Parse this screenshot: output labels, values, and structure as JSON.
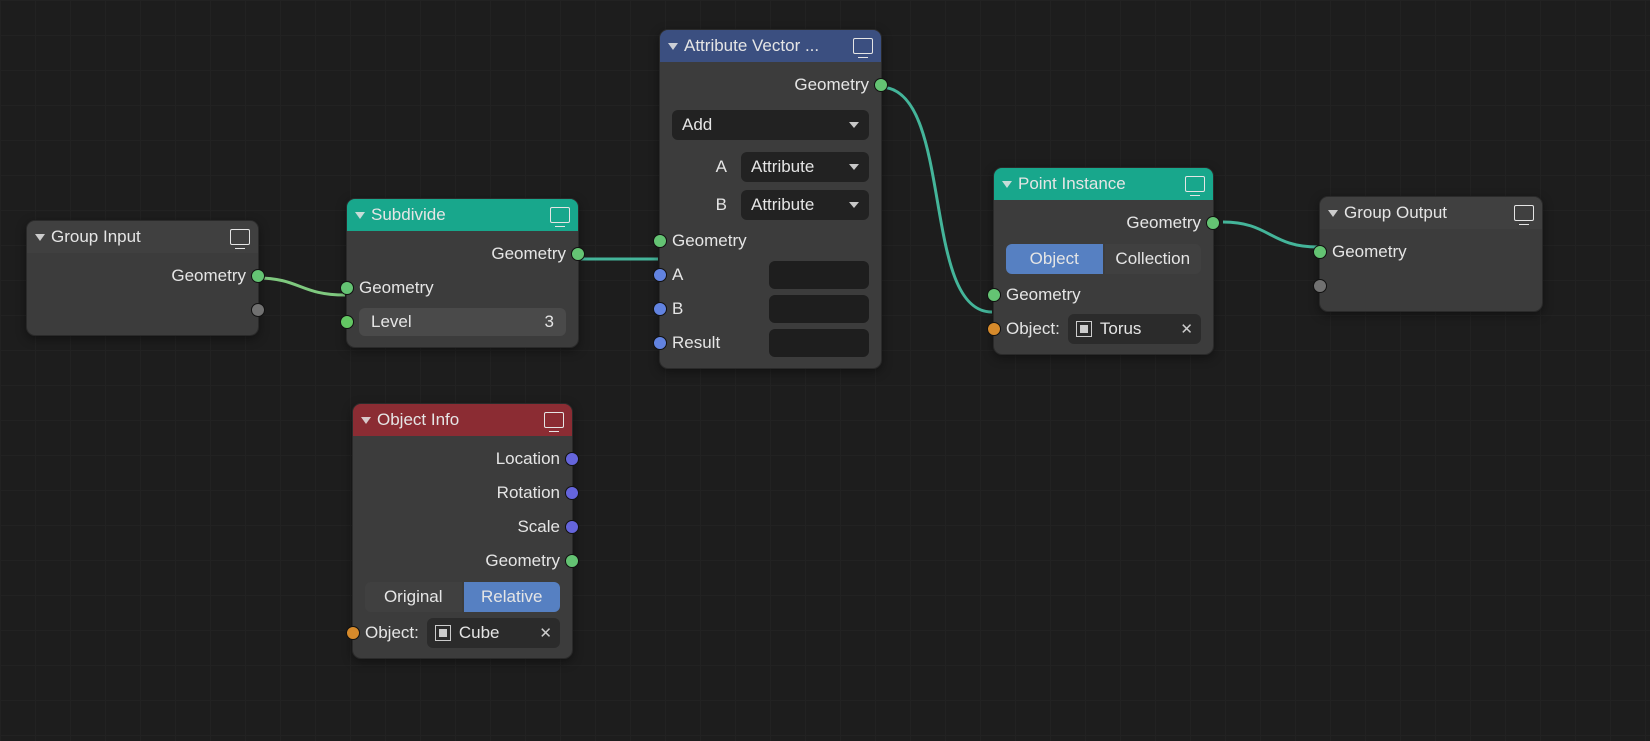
{
  "nodes": {
    "group_input": {
      "title": "Group Input",
      "out_geometry": "Geometry"
    },
    "subdivide": {
      "title": "Subdivide",
      "out_geometry": "Geometry",
      "in_geometry": "Geometry",
      "level_label": "Level",
      "level_value": "3"
    },
    "object_info": {
      "title": "Object Info",
      "out_location": "Location",
      "out_rotation": "Rotation",
      "out_scale": "Scale",
      "out_geometry": "Geometry",
      "mode_original": "Original",
      "mode_relative": "Relative",
      "object_label": "Object:",
      "object_value": "Cube"
    },
    "attr_vec": {
      "title": "Attribute Vector ...",
      "out_geometry": "Geometry",
      "operation": "Add",
      "a_label": "A",
      "a_mode": "Attribute",
      "b_label": "B",
      "b_mode": "Attribute",
      "in_geometry": "Geometry",
      "in_a": "A",
      "in_b": "B",
      "in_result": "Result"
    },
    "point_instance": {
      "title": "Point Instance",
      "out_geometry": "Geometry",
      "mode_object": "Object",
      "mode_collection": "Collection",
      "in_geometry": "Geometry",
      "object_label": "Object:",
      "object_value": "Torus"
    },
    "group_output": {
      "title": "Group Output",
      "in_geometry": "Geometry"
    }
  }
}
